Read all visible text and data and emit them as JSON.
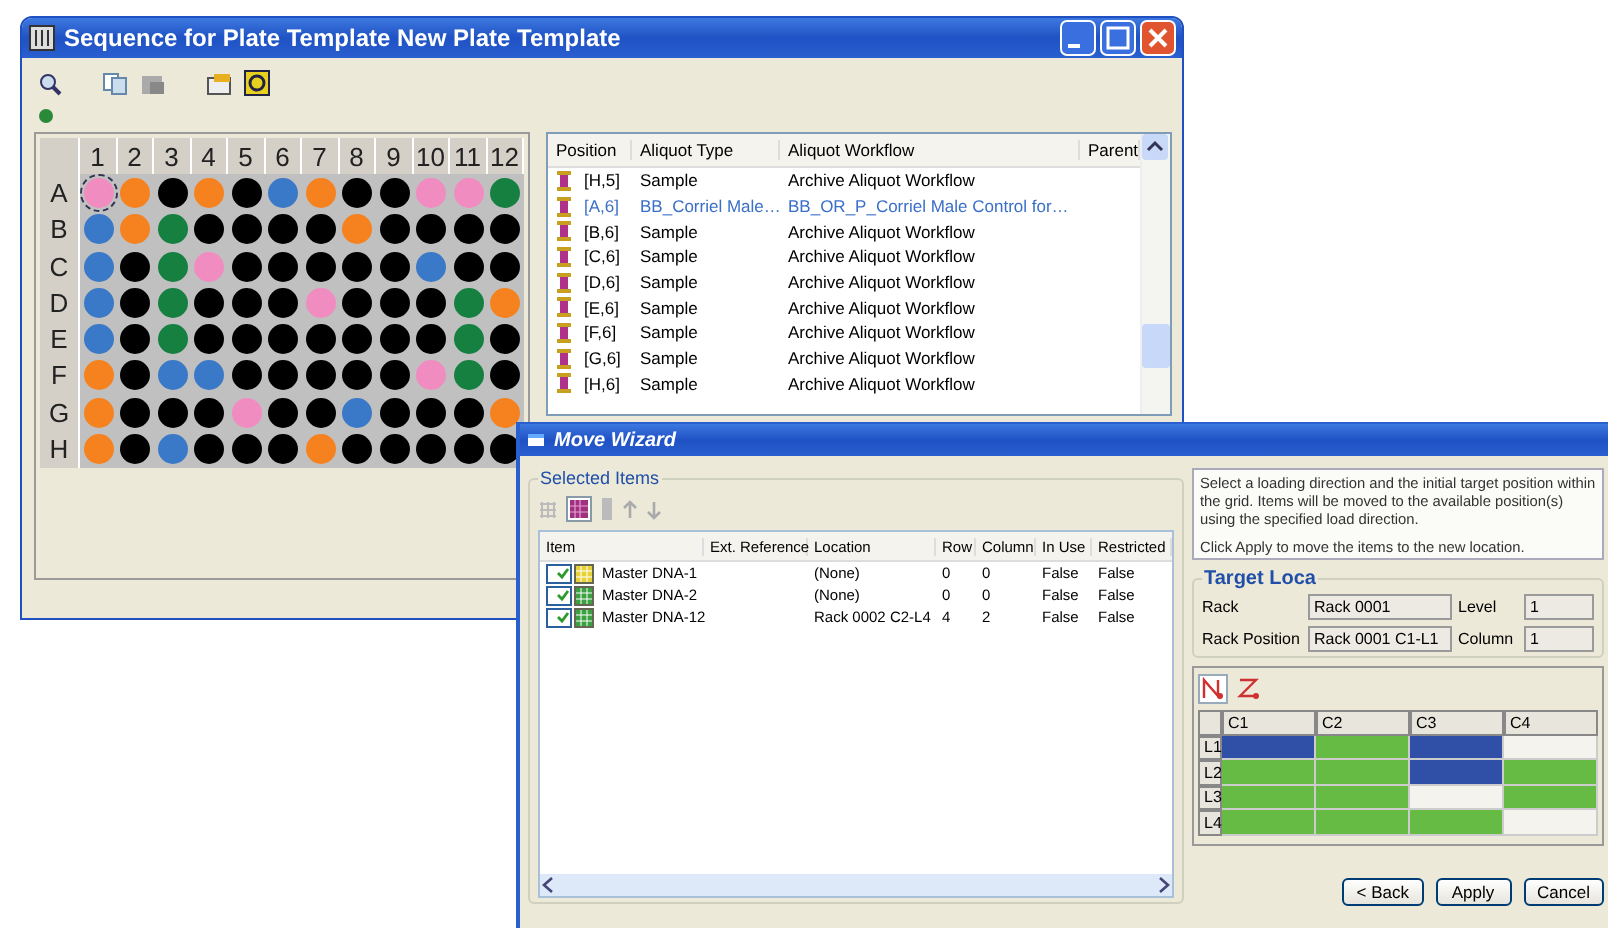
{
  "plate_window": {
    "title": "Sequence for Plate Template New Plate Template",
    "plate": {
      "columns": [
        "1",
        "2",
        "3",
        "4",
        "5",
        "6",
        "7",
        "8",
        "9",
        "10",
        "11",
        "12"
      ],
      "rows": [
        {
          "label": "A",
          "wells": [
            {
              "color": "#f08cc0",
              "selected": true
            },
            {
              "color": "#f5821f",
              "selected": false
            },
            {
              "color": "#000000",
              "selected": false
            },
            {
              "color": "#f5821f",
              "selected": false
            },
            {
              "color": "#000000",
              "selected": false
            },
            {
              "color": "#3a78c8",
              "selected": false
            },
            {
              "color": "#f5821f",
              "selected": false
            },
            {
              "color": "#000000",
              "selected": false
            },
            {
              "color": "#000000",
              "selected": false
            },
            {
              "color": "#f08cc0",
              "selected": false
            },
            {
              "color": "#f08cc0",
              "selected": false
            },
            {
              "color": "#168040",
              "selected": false
            }
          ]
        },
        {
          "label": "B",
          "wells": [
            {
              "color": "#3a78c8",
              "selected": false
            },
            {
              "color": "#f5821f",
              "selected": false
            },
            {
              "color": "#168040",
              "selected": false
            },
            {
              "color": "#000000",
              "selected": false
            },
            {
              "color": "#000000",
              "selected": false
            },
            {
              "color": "#000000",
              "selected": false
            },
            {
              "color": "#000000",
              "selected": false
            },
            {
              "color": "#f5821f",
              "selected": false
            },
            {
              "color": "#000000",
              "selected": false
            },
            {
              "color": "#000000",
              "selected": false
            },
            {
              "color": "#000000",
              "selected": false
            },
            {
              "color": "#000000",
              "selected": false
            }
          ]
        },
        {
          "label": "C",
          "wells": [
            {
              "color": "#3a78c8",
              "selected": false
            },
            {
              "color": "#000000",
              "selected": false
            },
            {
              "color": "#168040",
              "selected": false
            },
            {
              "color": "#f08cc0",
              "selected": false
            },
            {
              "color": "#000000",
              "selected": false
            },
            {
              "color": "#000000",
              "selected": false
            },
            {
              "color": "#000000",
              "selected": false
            },
            {
              "color": "#000000",
              "selected": false
            },
            {
              "color": "#000000",
              "selected": false
            },
            {
              "color": "#3a78c8",
              "selected": false
            },
            {
              "color": "#000000",
              "selected": false
            },
            {
              "color": "#000000",
              "selected": false
            }
          ]
        },
        {
          "label": "D",
          "wells": [
            {
              "color": "#3a78c8",
              "selected": false
            },
            {
              "color": "#000000",
              "selected": false
            },
            {
              "color": "#168040",
              "selected": false
            },
            {
              "color": "#000000",
              "selected": false
            },
            {
              "color": "#000000",
              "selected": false
            },
            {
              "color": "#000000",
              "selected": false
            },
            {
              "color": "#f08cc0",
              "selected": false
            },
            {
              "color": "#000000",
              "selected": false
            },
            {
              "color": "#000000",
              "selected": false
            },
            {
              "color": "#000000",
              "selected": false
            },
            {
              "color": "#168040",
              "selected": false
            },
            {
              "color": "#f5821f",
              "selected": false
            }
          ]
        },
        {
          "label": "E",
          "wells": [
            {
              "color": "#3a78c8",
              "selected": false
            },
            {
              "color": "#000000",
              "selected": false
            },
            {
              "color": "#168040",
              "selected": false
            },
            {
              "color": "#000000",
              "selected": false
            },
            {
              "color": "#000000",
              "selected": false
            },
            {
              "color": "#000000",
              "selected": false
            },
            {
              "color": "#000000",
              "selected": false
            },
            {
              "color": "#000000",
              "selected": false
            },
            {
              "color": "#000000",
              "selected": false
            },
            {
              "color": "#000000",
              "selected": false
            },
            {
              "color": "#168040",
              "selected": false
            },
            {
              "color": "#000000",
              "selected": false
            }
          ]
        },
        {
          "label": "F",
          "wells": [
            {
              "color": "#f5821f",
              "selected": false
            },
            {
              "color": "#000000",
              "selected": false
            },
            {
              "color": "#3a78c8",
              "selected": false
            },
            {
              "color": "#3a78c8",
              "selected": false
            },
            {
              "color": "#000000",
              "selected": false
            },
            {
              "color": "#000000",
              "selected": false
            },
            {
              "color": "#000000",
              "selected": false
            },
            {
              "color": "#000000",
              "selected": false
            },
            {
              "color": "#000000",
              "selected": false
            },
            {
              "color": "#f08cc0",
              "selected": false
            },
            {
              "color": "#168040",
              "selected": false
            },
            {
              "color": "#000000",
              "selected": false
            }
          ]
        },
        {
          "label": "G",
          "wells": [
            {
              "color": "#f5821f",
              "selected": false
            },
            {
              "color": "#000000",
              "selected": false
            },
            {
              "color": "#000000",
              "selected": false
            },
            {
              "color": "#000000",
              "selected": false
            },
            {
              "color": "#f08cc0",
              "selected": false
            },
            {
              "color": "#000000",
              "selected": false
            },
            {
              "color": "#000000",
              "selected": false
            },
            {
              "color": "#3a78c8",
              "selected": false
            },
            {
              "color": "#000000",
              "selected": false
            },
            {
              "color": "#000000",
              "selected": false
            },
            {
              "color": "#000000",
              "selected": false
            },
            {
              "color": "#f5821f",
              "selected": false
            }
          ]
        },
        {
          "label": "H",
          "wells": [
            {
              "color": "#f5821f",
              "selected": false
            },
            {
              "color": "#000000",
              "selected": false
            },
            {
              "color": "#3a78c8",
              "selected": false
            },
            {
              "color": "#000000",
              "selected": false
            },
            {
              "color": "#000000",
              "selected": false
            },
            {
              "color": "#000000",
              "selected": false
            },
            {
              "color": "#f5821f",
              "selected": false
            },
            {
              "color": "#000000",
              "selected": false
            },
            {
              "color": "#000000",
              "selected": false
            },
            {
              "color": "#000000",
              "selected": false
            },
            {
              "color": "#000000",
              "selected": false
            },
            {
              "color": "#000000",
              "selected": false
            }
          ]
        }
      ]
    },
    "list": {
      "columns": [
        "Position",
        "Aliquot Type",
        "Aliquot Workflow",
        "Parent"
      ],
      "rows": [
        {
          "position": "[H,5]",
          "type": "Sample",
          "workflow": "Archive Aliquot Workflow",
          "highlighted": false
        },
        {
          "position": "[A,6]",
          "type": "BB_Corriel Male…",
          "workflow": "BB_OR_P_Corriel Male Control for…",
          "highlighted": true
        },
        {
          "position": "[B,6]",
          "type": "Sample",
          "workflow": "Archive Aliquot Workflow",
          "highlighted": false
        },
        {
          "position": "[C,6]",
          "type": "Sample",
          "workflow": "Archive Aliquot Workflow",
          "highlighted": false
        },
        {
          "position": "[D,6]",
          "type": "Sample",
          "workflow": "Archive Aliquot Workflow",
          "highlighted": false
        },
        {
          "position": "[E,6]",
          "type": "Sample",
          "workflow": "Archive Aliquot Workflow",
          "highlighted": false
        },
        {
          "position": "[F,6]",
          "type": "Sample",
          "workflow": "Archive Aliquot Workflow",
          "highlighted": false
        },
        {
          "position": "[G,6]",
          "type": "Sample",
          "workflow": "Archive Aliquot Workflow",
          "highlighted": false
        },
        {
          "position": "[H,6]",
          "type": "Sample",
          "workflow": "Archive Aliquot Workflow",
          "highlighted": false
        }
      ]
    }
  },
  "move_wizard": {
    "title": "Move Wizard",
    "selected_items": {
      "title": "Selected Items",
      "columns": [
        "Item",
        "Ext. Reference",
        "Location",
        "Row",
        "Column",
        "In Use",
        "Restricted"
      ],
      "rows": [
        {
          "checked": true,
          "color": "#e8d23a",
          "item": "Master DNA-1",
          "location": "(None)",
          "row": "0",
          "column": "0",
          "in_use": "False",
          "restricted": "False"
        },
        {
          "checked": true,
          "color": "#3aa040",
          "item": "Master DNA-2",
          "location": "(None)",
          "row": "0",
          "column": "0",
          "in_use": "False",
          "restricted": "False"
        },
        {
          "checked": true,
          "color": "#3aa040",
          "item": "Master DNA-12",
          "location": "Rack 0002 C2-L4",
          "row": "4",
          "column": "2",
          "in_use": "False",
          "restricted": "False"
        }
      ]
    },
    "instructions": [
      "Select a loading direction and the initial target position within the grid. Items will be moved to the available position(s) using the specified load direction.",
      "Click Apply to move the items to the new location."
    ],
    "target": {
      "title": "Target Loca",
      "fields": [
        {
          "label": "Rack",
          "value": "Rack 0001"
        },
        {
          "label": "Level",
          "value": "1"
        },
        {
          "label": "Rack Position",
          "value": "Rack 0001 C1-L1"
        },
        {
          "label": "Column",
          "value": "1"
        }
      ]
    },
    "directions": [
      {
        "kind": "vertical",
        "selected": true
      },
      {
        "kind": "zigzag",
        "selected": false
      }
    ],
    "rack_grid": {
      "columns": [
        "C1",
        "C2",
        "C3",
        "C4"
      ],
      "rows": [
        {
          "label": "L1",
          "cells": [
            {
              "kind": "target"
            },
            {
              "kind": "occupied"
            },
            {
              "kind": "target"
            },
            {
              "kind": "empty"
            }
          ]
        },
        {
          "label": "L2",
          "cells": [
            {
              "kind": "occupied"
            },
            {
              "kind": "occupied"
            },
            {
              "kind": "target"
            },
            {
              "kind": "occupied"
            }
          ]
        },
        {
          "label": "L3",
          "cells": [
            {
              "kind": "occupied"
            },
            {
              "kind": "occupied"
            },
            {
              "kind": "empty"
            },
            {
              "kind": "occupied"
            }
          ]
        },
        {
          "label": "L4",
          "cells": [
            {
              "kind": "occupied"
            },
            {
              "kind": "occupied"
            },
            {
              "kind": "occupied"
            },
            {
              "kind": "empty"
            }
          ]
        }
      ]
    },
    "buttons": [
      "< Back",
      "Apply",
      "Cancel"
    ]
  }
}
